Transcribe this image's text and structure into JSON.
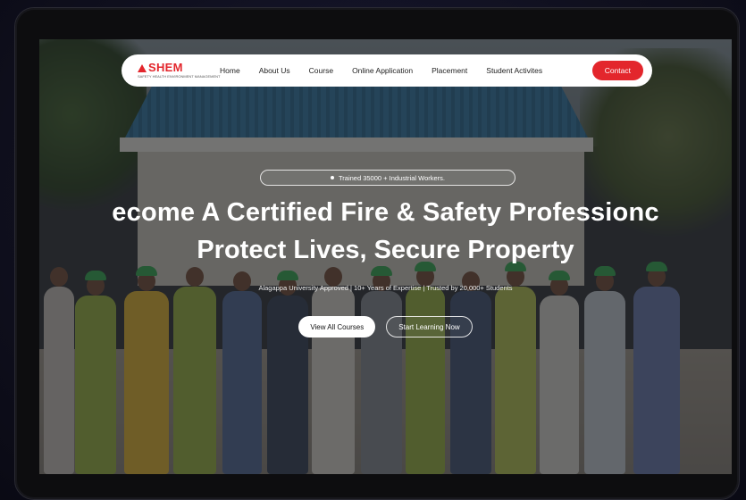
{
  "nav": {
    "logo_text": "SHEM",
    "logo_subtitle": "SAFETY HEALTH ENVIRONMENT MANAGEMENT",
    "items": [
      {
        "label": "Home"
      },
      {
        "label": "About Us"
      },
      {
        "label": "Course"
      },
      {
        "label": "Online Application"
      },
      {
        "label": "Placement"
      },
      {
        "label": "Student Activites"
      }
    ],
    "contact_label": "Contact"
  },
  "hero": {
    "badge_text": "Trained 35000 + Industrial Workers.",
    "headline_line1": "ecome A Certified Fire & Safety Professionc",
    "headline_line2": "Protect Lives, Secure Property",
    "subtitle": "Alagappa University Approved | 10+ Years of Expertise | Trusted by 20,000+ Students",
    "primary_cta": "View All Courses",
    "secondary_cta": "Start Learning Now"
  },
  "colors": {
    "brand_red": "#e3262c",
    "overlay": "#121418",
    "outer_background": "#10101f"
  },
  "icons": [
    "logo-triangle-icon",
    "badge-dot-icon"
  ]
}
